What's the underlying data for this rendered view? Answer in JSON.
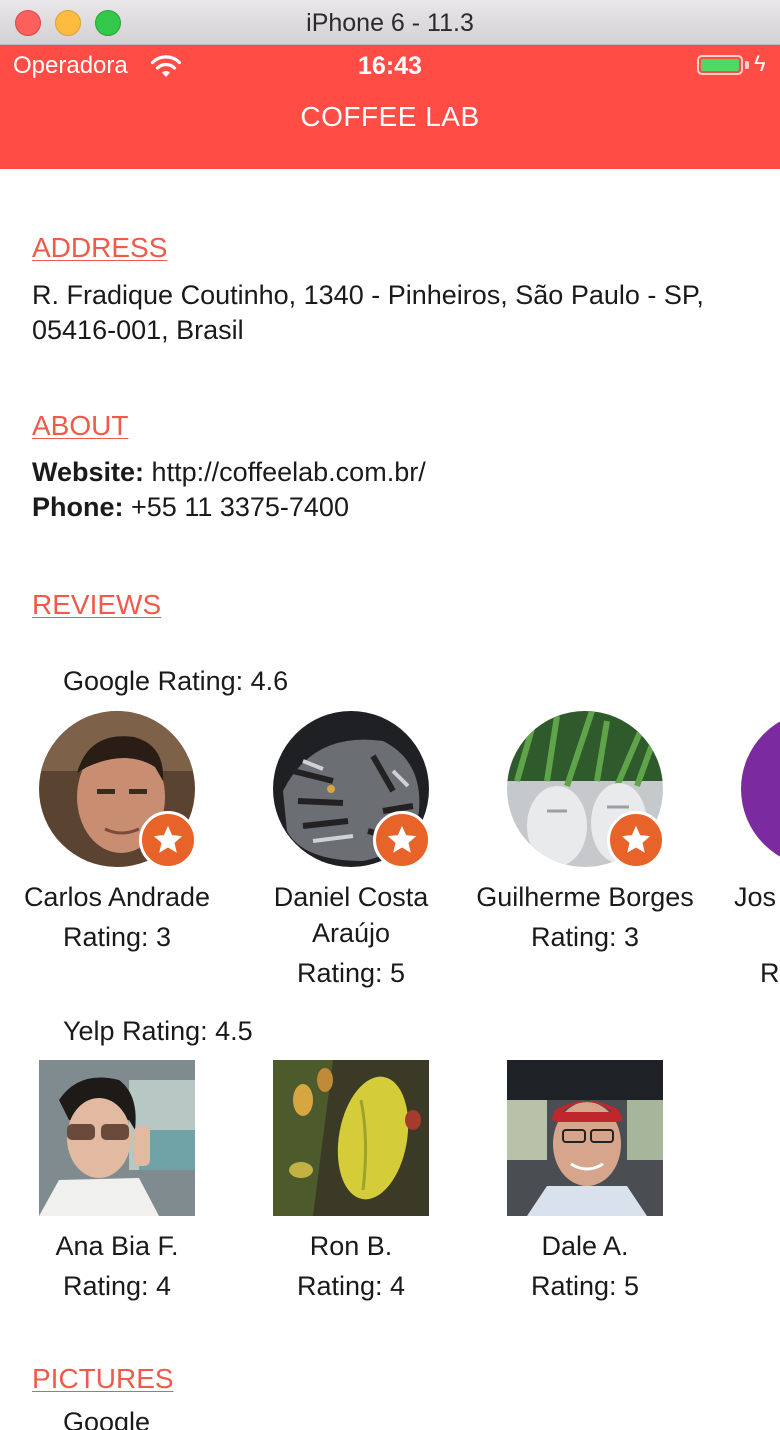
{
  "window": {
    "title": "iPhone 6 - 11.3"
  },
  "status_bar": {
    "carrier": "Operadora",
    "time": "16:43"
  },
  "nav": {
    "title": "COFFEE LAB"
  },
  "address": {
    "heading": "ADDRESS",
    "text": "R. Fradique Coutinho, 1340 - Pinheiros, São Paulo - SP, 05416-001, Brasil"
  },
  "about": {
    "heading": "ABOUT",
    "website_label": "Website:",
    "website": "http://coffeelab.com.br/",
    "phone_label": "Phone:",
    "phone": "+55 11 3375-7400"
  },
  "reviews": {
    "heading": "REVIEWS",
    "google": {
      "title": "Google Rating: 4.6",
      "reviewers": [
        {
          "name": "Carlos Andrade",
          "rating": "Rating: 3"
        },
        {
          "name": "Daniel Costa Araújo",
          "rating": "Rating: 5"
        },
        {
          "name": "Guilherme Borges",
          "rating": "Rating: 3"
        },
        {
          "name": "Jos",
          "rating": "Ra"
        }
      ]
    },
    "yelp": {
      "title": "Yelp Rating: 4.5",
      "reviewers": [
        {
          "name": "Ana Bia F.",
          "rating": "Rating: 4"
        },
        {
          "name": "Ron B.",
          "rating": "Rating: 4"
        },
        {
          "name": "Dale A.",
          "rating": "Rating: 5"
        }
      ]
    }
  },
  "pictures": {
    "heading": "PICTURES",
    "sub": "Google"
  },
  "colors": {
    "header": "#ff4d45",
    "heading_link": "#ef5a4a",
    "badge": "#e8632a"
  }
}
